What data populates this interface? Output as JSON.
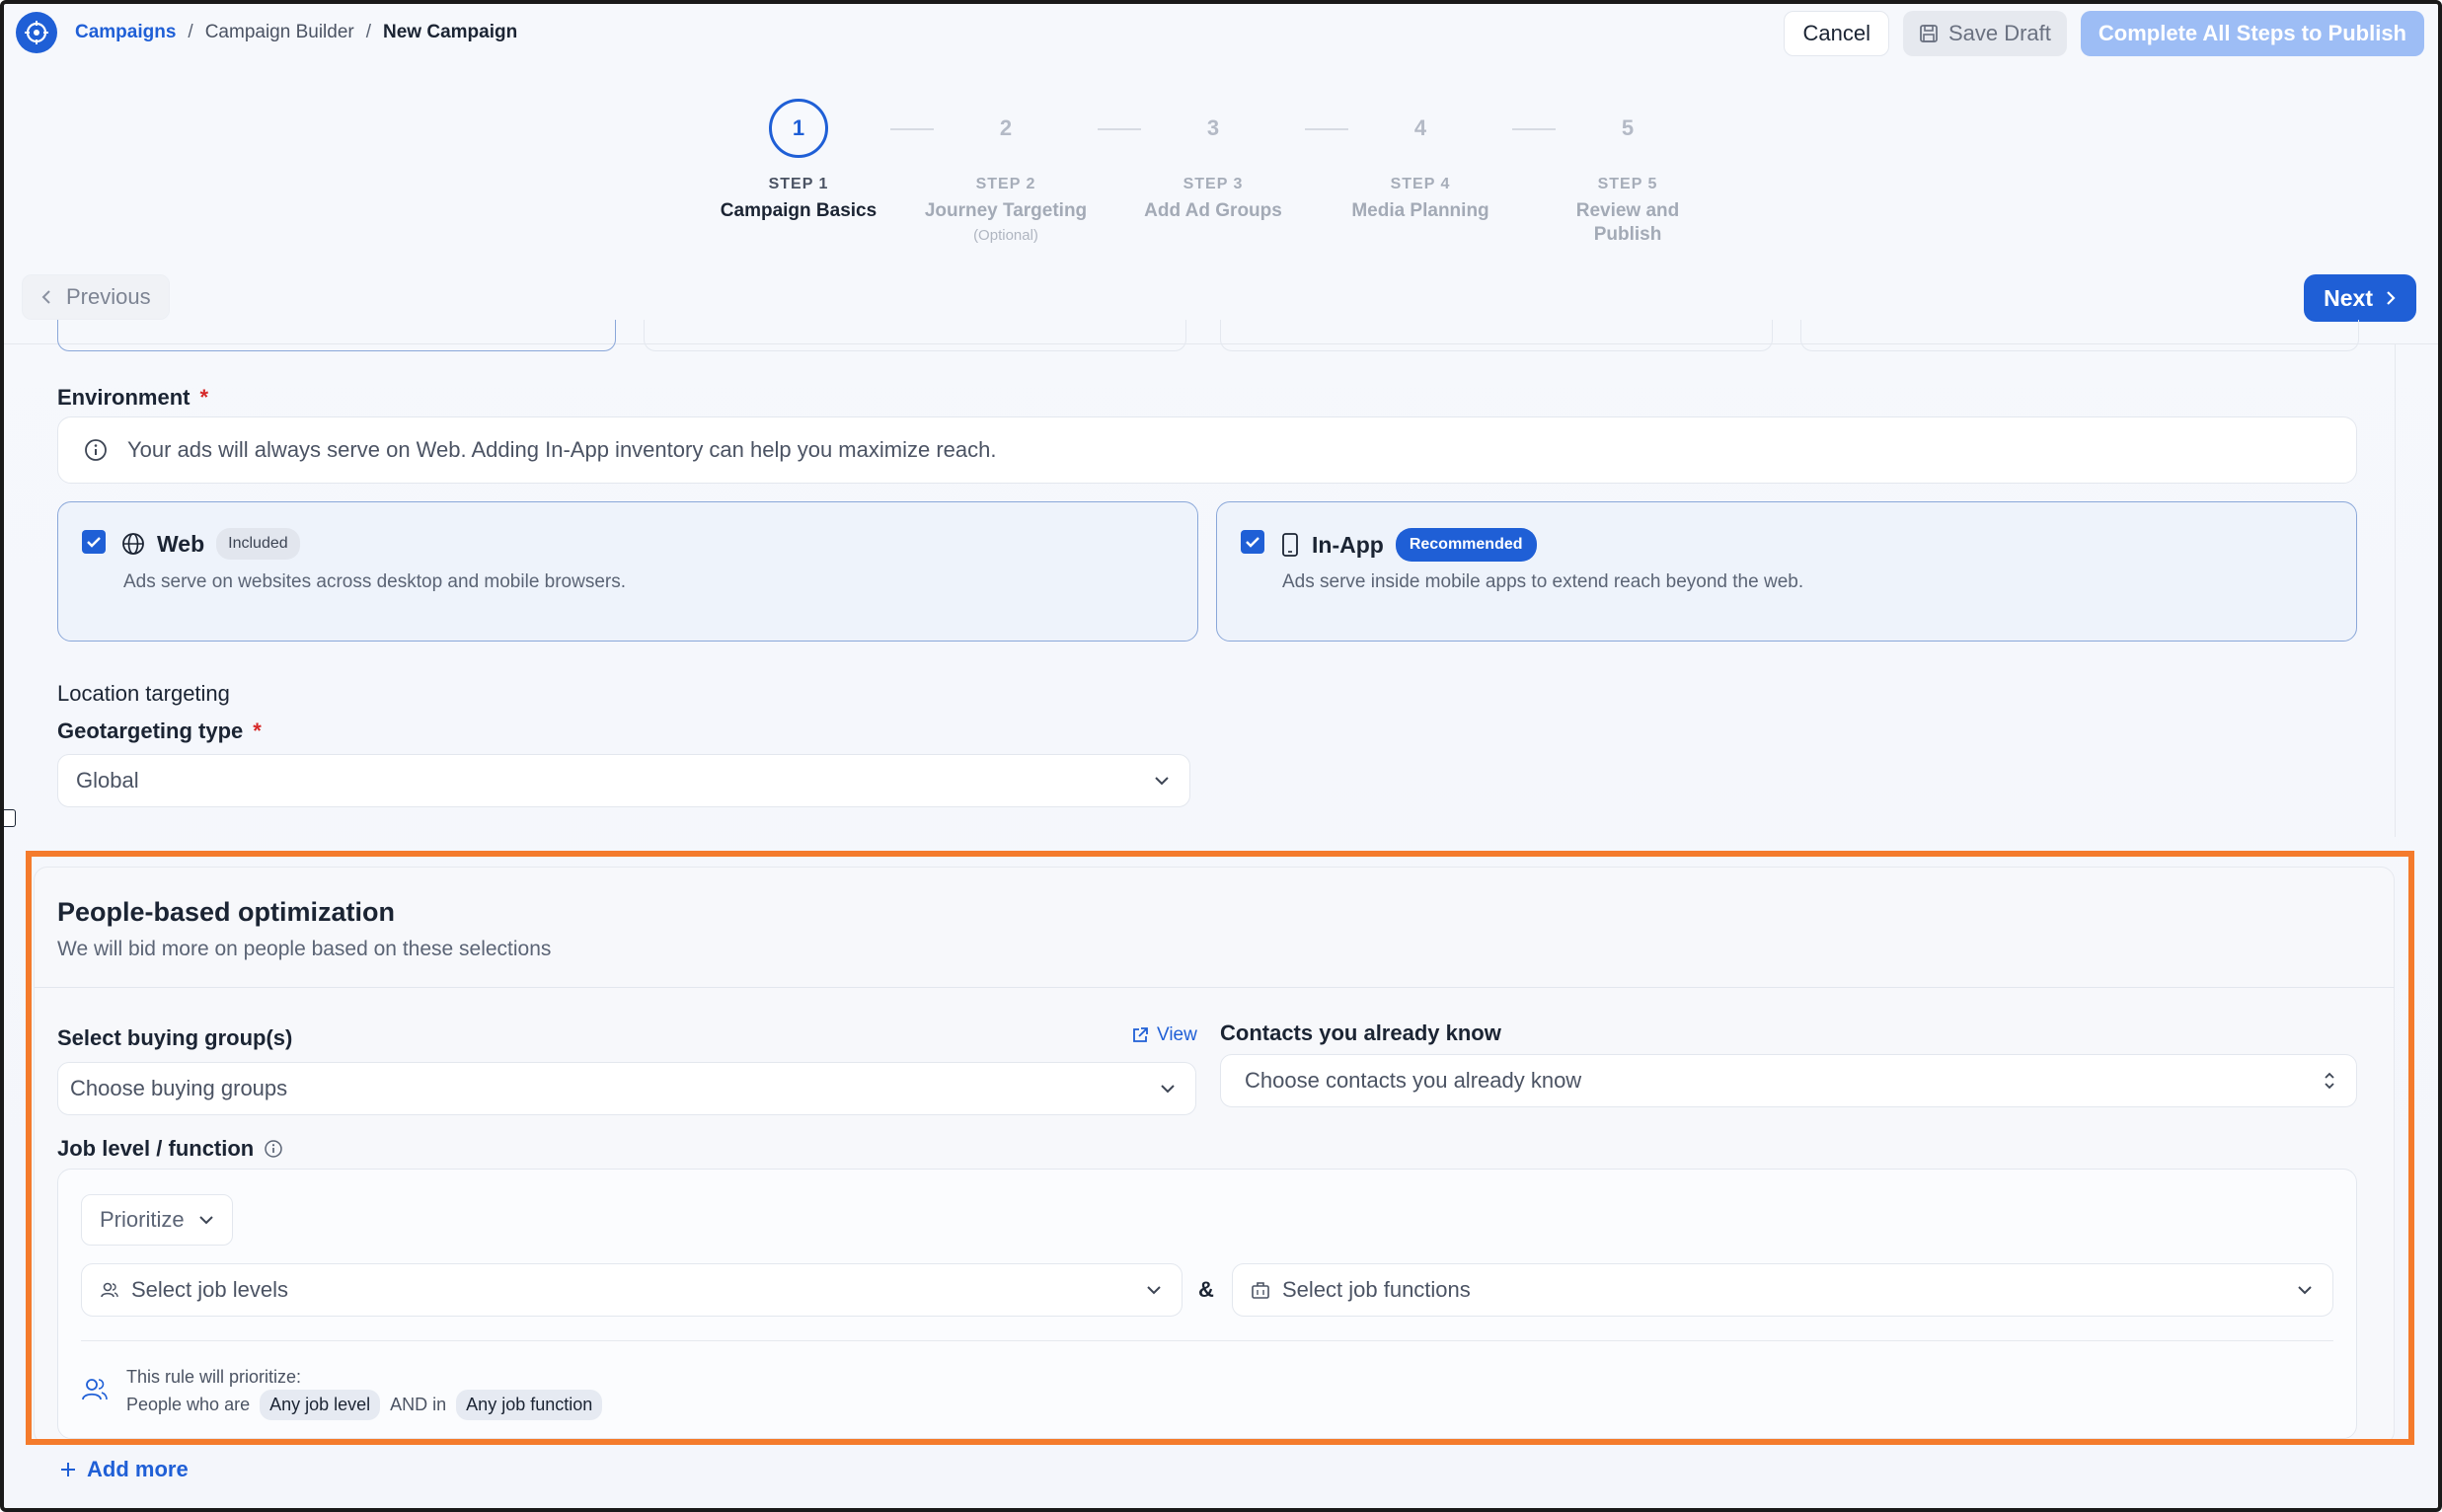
{
  "breadcrumb": [
    "Campaigns",
    "Campaign Builder",
    "New Campaign"
  ],
  "top_actions": {
    "cancel": "Cancel",
    "save_draft": "Save Draft",
    "publish": "Complete All Steps to Publish"
  },
  "steps": [
    {
      "circle": "1",
      "num": "STEP 1",
      "name": "Campaign Basics",
      "optional": "",
      "active": true
    },
    {
      "circle": "2",
      "num": "STEP 2",
      "name": "Journey Targeting",
      "optional": "(Optional)",
      "active": false
    },
    {
      "circle": "3",
      "num": "STEP 3",
      "name": "Add Ad Groups",
      "optional": "",
      "active": false
    },
    {
      "circle": "4",
      "num": "STEP 4",
      "name": "Media Planning",
      "optional": "",
      "active": false
    },
    {
      "circle": "5",
      "num": "STEP 5",
      "name": "Review and Publish",
      "optional": "",
      "active": false
    }
  ],
  "nav": {
    "previous": "Previous",
    "next": "Next"
  },
  "environment": {
    "label": "Environment",
    "required_mark": "*",
    "info": "Your ads will always serve on Web. Adding In-App inventory can help you maximize reach.",
    "options": [
      {
        "title": "Web",
        "badge": "Included",
        "desc": "Ads serve on websites across desktop and mobile browsers.",
        "checked": true
      },
      {
        "title": "In-App",
        "badge": "Recommended",
        "desc": "Ads serve inside mobile apps to extend reach beyond the web.",
        "checked": true
      }
    ]
  },
  "location": {
    "heading": "Location targeting",
    "geo_label": "Geotargeting type",
    "required_mark": "*",
    "geo_value": "Global"
  },
  "people": {
    "title": "People-based optimization",
    "subtitle": "We will bid more on people based on these selections",
    "buying_label": "Select buying group(s)",
    "view_link": "View",
    "buying_placeholder": "Choose buying groups",
    "contacts_label": "Contacts you already know",
    "contacts_placeholder": "Choose contacts you already know",
    "job_label": "Job level / function",
    "rule": {
      "mode": "Prioritize",
      "levels_placeholder": "Select job levels",
      "amp": "&",
      "functions_placeholder": "Select job functions",
      "summary_line1": "This rule will prioritize:",
      "summary_prefix": "People who are",
      "chip_level": "Any job level",
      "summary_mid": "AND in",
      "chip_function": "Any job function"
    },
    "add_more": "Add more"
  },
  "colors": {
    "accent": "#1f5fd6",
    "highlight": "#f47b2c",
    "required": "#d62828"
  }
}
